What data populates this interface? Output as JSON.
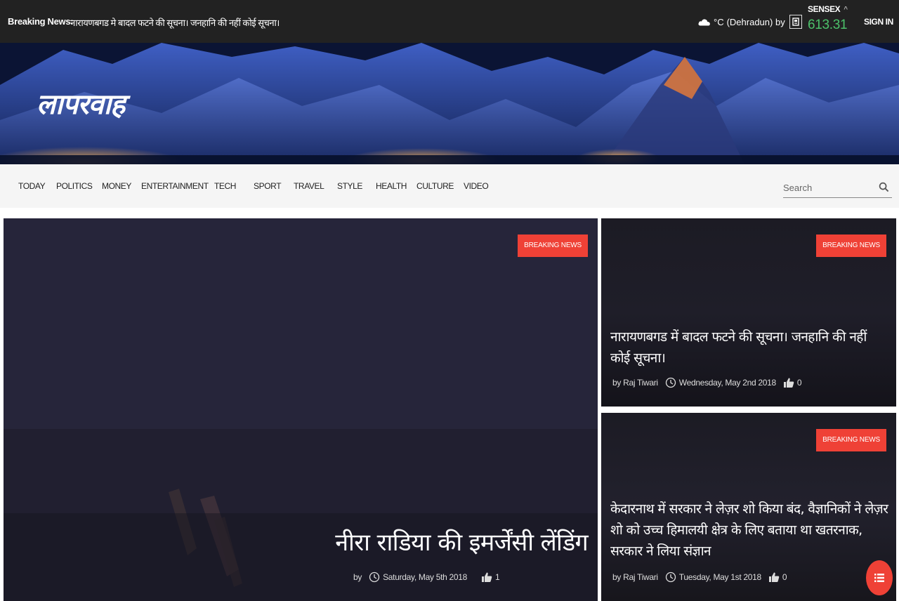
{
  "topbar": {
    "breaking_label": "Breaking News:",
    "breaking_text": "नारायणबगड मे बादल फटने की सूचना। जनहानि की नहीं कोई सूचना।",
    "weather": {
      "icon": "cloud-icon",
      "unit_text": "°C",
      "location_text": "(Dehradun) by",
      "provider_icon": "weather-provider-logo"
    },
    "sensex": {
      "label": "SENSEX",
      "trend_icon": "caret-up-icon",
      "value": "613.31",
      "value_color": "#4cc16a"
    },
    "signin_label": "SIGN IN"
  },
  "banner": {
    "logo_text": "लापरवाह"
  },
  "nav": {
    "items": [
      {
        "label": "TODAY"
      },
      {
        "label": "POLITICS"
      },
      {
        "label": "MONEY"
      },
      {
        "label": "ENTERTAINMENT"
      },
      {
        "label": "TECH"
      },
      {
        "label": "SPORT"
      },
      {
        "label": "TRAVEL"
      },
      {
        "label": "STYLE"
      },
      {
        "label": "HEALTH"
      },
      {
        "label": "CULTURE"
      },
      {
        "label": "VIDEO"
      }
    ],
    "search": {
      "placeholder": "Search",
      "icon": "search-icon"
    }
  },
  "articles": {
    "main": {
      "badge": "BREAKING NEWS",
      "title": "नीरा राडिया की इमर्जेंसी लेंडिंग",
      "by": "by",
      "author": "",
      "date": "Saturday, May 5th 2018",
      "likes": "1"
    },
    "side1": {
      "badge": "BREAKING NEWS",
      "title": "नारायणबगड में बादल फटने की सूचना। जनहानि की नहीं कोई सूचना।",
      "by": "by Raj Tiwari",
      "date": "Wednesday, May 2nd 2018",
      "likes": "0"
    },
    "side2": {
      "badge": "BREAKING NEWS",
      "title": "केदारनाथ में सरकार ने लेज़र शो किया बंद, वैज्ञानिकों ने लेज़र शो को उच्च हिमालयी क्षेत्र के लिए बताया था खतरनाक, सरकार ने लिया संज्ञान",
      "by": "by Raj Tiwari",
      "date": "Tuesday, May 1st 2018",
      "likes": "0"
    }
  },
  "colors": {
    "accent": "#ef4136",
    "topbar_bg": "#222222",
    "nav_bg": "#f5f5f5"
  },
  "fab": {
    "icon": "list-menu-icon"
  }
}
